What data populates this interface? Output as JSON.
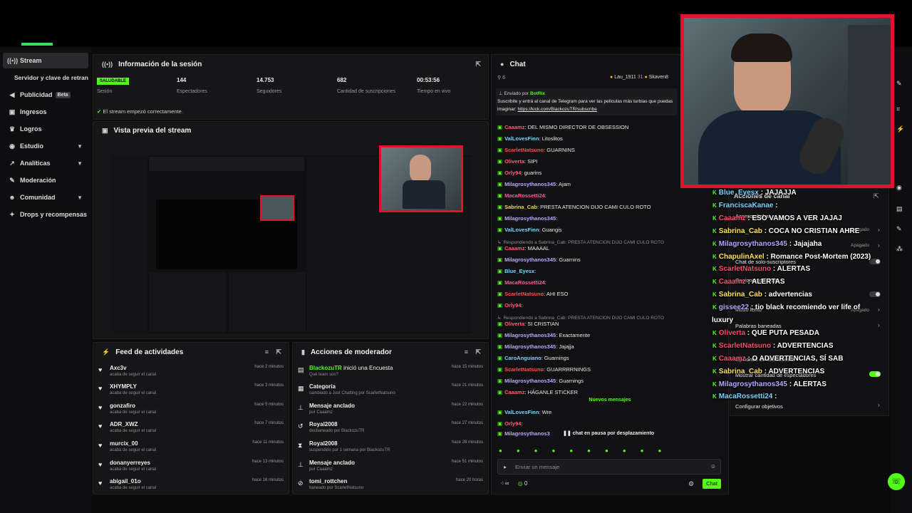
{
  "sidebar": {
    "items": [
      {
        "label": "Stream",
        "icon": "broadcast-icon"
      },
      {
        "label": "Servidor y clave de retransmisión",
        "icon": ""
      },
      {
        "label": "Publicidad",
        "icon": "megaphone-icon",
        "badge": "Beta"
      },
      {
        "label": "Ingresos",
        "icon": "money-icon"
      },
      {
        "label": "Logros",
        "icon": "trophy-icon"
      },
      {
        "label": "Estudio",
        "icon": "studio-icon"
      },
      {
        "label": "Analíticas",
        "icon": "analytics-icon"
      },
      {
        "label": "Moderación",
        "icon": "wrench-icon"
      },
      {
        "label": "Comunidad",
        "icon": "community-icon"
      },
      {
        "label": "Drops y recompensas",
        "icon": "gift-icon"
      }
    ]
  },
  "session": {
    "title": "Información de la sesión",
    "status_badge": "SALUDABLE",
    "status_label": "Sesión",
    "viewers_value": "144",
    "viewers_label": "Espectadores",
    "followers_value": "14.753",
    "followers_label": "Seguidores",
    "subs_value": "682",
    "subs_label": "Cantidad de suscripciones",
    "live_value": "00:53:56",
    "live_label": "Tiempo en vivo",
    "ok_message": "El stream empezó correctamente."
  },
  "preview": {
    "title": "Vista previa del stream"
  },
  "feed": {
    "title": "Feed de actividades",
    "rows": [
      {
        "name": "Axc3v",
        "sub": "acaba de seguir el canal",
        "time": "hace 2 minutos"
      },
      {
        "name": "XHYMPLY",
        "sub": "acaba de seguir el canal",
        "time": "hace 3 minutos"
      },
      {
        "name": "gonzafiro",
        "sub": "acaba de seguir el canal",
        "time": "hace 5 minutos"
      },
      {
        "name": "ADR_XWZ",
        "sub": "acaba de seguir el canal",
        "time": "hace 7 minutos"
      },
      {
        "name": "murcix_00",
        "sub": "acaba de seguir el canal",
        "time": "hace 11 minutos"
      },
      {
        "name": "donanyerreyes",
        "sub": "acaba de seguir el canal",
        "time": "hace 13 minutos"
      },
      {
        "name": "abigail_01o",
        "sub": "acaba de seguir el canal",
        "time": "hace 16 minutos"
      }
    ]
  },
  "modactions": {
    "title": "Acciones de moderador",
    "rows": [
      {
        "icon": "poll-icon",
        "name": "BlackozuTR",
        "action": "inició una Encuesta",
        "sub": "Qué team sos?",
        "time": "hace 15 minutos"
      },
      {
        "icon": "category-icon",
        "name": "Categoría",
        "action": "",
        "sub": "cambiado a Just Chatting por ScarletNatsuno",
        "time": "hace 21 minutos"
      },
      {
        "icon": "pin-icon",
        "name": "Mensaje anclado",
        "action": "",
        "sub": "por Caaamz",
        "time": "hace 22 minutos"
      },
      {
        "icon": "unban-icon",
        "name": "Royal2008",
        "action": "",
        "sub": "desbaneado por BlackozuTR",
        "time": "hace 27 minutos"
      },
      {
        "icon": "hourglass-icon",
        "name": "Royal2008",
        "action": "",
        "sub": "suspendido por 1 semana por BlackozuTR",
        "time": "hace 28 minutos"
      },
      {
        "icon": "pin-icon",
        "name": "Mensaje anclado",
        "action": "",
        "sub": "por Caaamz",
        "time": "hace 51 minutos"
      },
      {
        "icon": "ban-icon",
        "name": "tomi_rottchen",
        "action": "",
        "sub": "baneado por ScarletNatsuno",
        "time": "hace 20 horas"
      }
    ]
  },
  "chat": {
    "title": "Chat",
    "count": "6",
    "top_user1": "Lau_1911",
    "top_user1_count": "31",
    "top_user2": "Skaven8",
    "pinned_by": "Enviado por",
    "pinned_bot": "BotRix",
    "pinned_text": "Suscribite y entrá al canal de Telegram para ver las películas más turbias que puedas",
    "pinned_text2": "imaginar:",
    "pinned_link": "https://kick.com/BlackozuTR/subscribe",
    "messages": [
      {
        "user": "Caaamz",
        "text": ": DEL MISMO DIRECTOR DE OBSESSION",
        "color": "#ff5a7a"
      },
      {
        "user": "ValLovesFinn",
        "text": ": Litoslitos",
        "color": "#7ad3ff"
      },
      {
        "user": "ScarletNatsuno",
        "text": ": GUARNINS",
        "color": "#ff4d4d"
      },
      {
        "user": "Oliverta",
        "text": ": SIPI",
        "color": "#ff5a7a"
      },
      {
        "user": "Orly94",
        "text": ": guarins",
        "color": "#ff5a7a"
      },
      {
        "user": "Milagrosythanos345",
        "text": ": Ajam",
        "color": "#b9a7ff"
      },
      {
        "user": "MacaRossetti24",
        "text": ":",
        "color": "#ff5a9a"
      },
      {
        "user": "Sabrina_Cab",
        "text": ": PRESTA ATENCION DIJO CAMI CULO ROTO",
        "color": "#e9d36a"
      },
      {
        "user": "Milagrosythanos345",
        "text": ":",
        "color": "#b9a7ff"
      },
      {
        "user": "ValLovesFinn",
        "text": ": Guangis",
        "color": "#7ad3ff"
      },
      {
        "user": "",
        "text": "Respondiendo a Sabrina_Cab: PRESTA ATENCION DIJO CAMI CULO ROTO",
        "color": "#8f8f93"
      },
      {
        "user": "Caaamz",
        "text": ": MAAAAL",
        "color": "#ff5a7a"
      },
      {
        "user": "Milagrosythanos345",
        "text": ": Guarnins",
        "color": "#b9a7ff"
      },
      {
        "user": "Blue_Eyesx",
        "text": ":",
        "color": "#7ad3ff"
      },
      {
        "user": "MacaRossetti24",
        "text": ":",
        "color": "#ff5a9a"
      },
      {
        "user": "ScarletNatsuno",
        "text": ": AHI ESO",
        "color": "#ff4d4d"
      },
      {
        "user": "Orly94",
        "text": ":",
        "color": "#ff5a7a"
      },
      {
        "user": "",
        "text": "Respondiendo a Sabrina_Cab: PRESTA ATENCION DIJO CAMI CULO ROTO",
        "color": "#8f8f93"
      },
      {
        "user": "Oliverta",
        "text": ": SI CRISTIAN",
        "color": "#ff5a7a"
      },
      {
        "user": "Milagrosythanos345",
        "text": ": Exactamente",
        "color": "#b9a7ff"
      },
      {
        "user": "Milagrosythanos345",
        "text": ": Jajajja",
        "color": "#b9a7ff"
      },
      {
        "user": "CaroAnguiano",
        "text": ": Guarnings",
        "color": "#7ad3ff"
      },
      {
        "user": "ScarletNatsuno",
        "text": ": GUARRRRNINGS",
        "color": "#ff4d4d"
      },
      {
        "user": "Milagrosythanos345",
        "text": ": Guarnings",
        "color": "#b9a7ff"
      },
      {
        "user": "Caaamz",
        "text": ": HÁGANLE STICKER",
        "color": "#ff5a7a"
      }
    ],
    "new_messages": "Nuevos mensajes",
    "after": [
      {
        "user": "ValLovesFinn",
        "text": ": Wre",
        "color": "#7ad3ff"
      },
      {
        "user": "Orly94",
        "text": ":",
        "color": "#ff5a7a"
      },
      {
        "user": "Milagrosythanos3",
        "text": "",
        "color": "#b9a7ff"
      }
    ],
    "paused": "chat en pausa por desplazamiento",
    "input_placeholder": "Enviar un mensaje",
    "points": "0",
    "send_label": "Chat"
  },
  "channel_actions": {
    "title": "Acciones de canal",
    "items": [
      {
        "label": "Acceso al chat",
        "value": "Apagado"
      },
      {
        "label": "Chat de solo-suscriptores",
        "value": ""
      },
      {
        "label": "Opciones de chat",
        "value": "Apagado"
      },
      {
        "label": "Modo lento",
        "value": "Apagado"
      },
      {
        "label": "Palabras baneadas",
        "value": ""
      },
      {
        "label": "Opciones de la encuesta",
        "value": ""
      },
      {
        "label": "Mostrar cantidad de espectadores",
        "value": ""
      },
      {
        "label": "Configurar objetivos",
        "value": ""
      }
    ]
  },
  "overlay_chat": [
    {
      "user": "Blue_Eyesx",
      "text": " : JAJAJJA",
      "cls": "ov-u"
    },
    {
      "user": "FranciscaKanae",
      "text": " : ",
      "cls": "ov-u"
    },
    {
      "user": "Caaamz",
      "text": " : ESO VAMOS A VER JAJAJ",
      "cls": "ov-u2"
    },
    {
      "user": "Sabrina_Cab",
      "text": " : COCA NO CRISTIAN AHRE",
      "cls": "ov-u4"
    },
    {
      "user": "Milagrosythanos345",
      "text": " : Jajajaha",
      "cls": "ov-u3"
    },
    {
      "user": "ChapulinAxel",
      "text": " : Romance Post-Mortem (2023)",
      "cls": "ov-u4"
    },
    {
      "user": "ScarletNatsuno",
      "text": " : ALERTAS",
      "cls": "ov-u2"
    },
    {
      "user": "Caaamz",
      "text": " : ALERTAS",
      "cls": "ov-u2"
    },
    {
      "user": "Sabrina_Cab",
      "text": " : advertencias",
      "cls": "ov-u4"
    },
    {
      "user": "gissee22",
      "text": " : tio black recomiendo ver life of",
      "cls": "ov-u3"
    },
    {
      "user": "",
      "text": "luxury",
      "cls": "ov-u3"
    },
    {
      "user": "Oliverta",
      "text": " : QUE PUTA PESADA",
      "cls": "ov-u2"
    },
    {
      "user": "ScarletNatsuno",
      "text": " : ADVERTENCIAS",
      "cls": "ov-u2"
    },
    {
      "user": "Caaamz",
      "text": " : O ADVERTENCIAS, SÍ SAB",
      "cls": "ov-u2"
    },
    {
      "user": "Sabrina_Cab",
      "text": " : ADVERTENCIAS",
      "cls": "ov-u4"
    },
    {
      "user": "Milagrosythanos345",
      "text": " : ALERTAS",
      "cls": "ov-u3"
    },
    {
      "user": "MacaRossetti24",
      "text": " : ",
      "cls": "ov-u"
    }
  ],
  "colors": {
    "accent": "#53fc18",
    "camera_border": "#e3112b"
  }
}
